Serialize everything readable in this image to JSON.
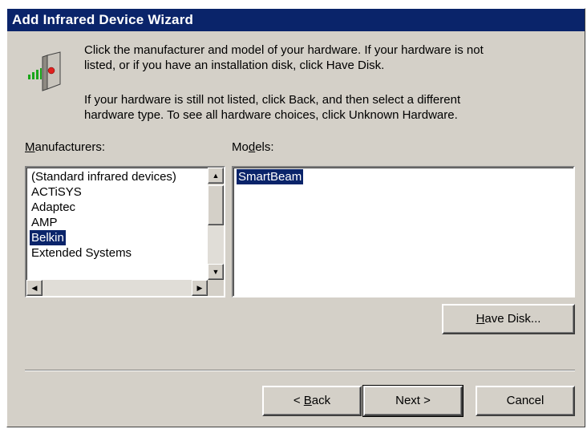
{
  "window": {
    "title": "Add Infrared Device Wizard"
  },
  "instructions": {
    "line1": "Click the manufacturer and model of your hardware. If your hardware is not",
    "line2": "listed, or if you have an installation disk, click Have Disk.",
    "line3": "If your hardware is still not listed, click Back, and then select a different",
    "line4": "hardware type. To see all hardware choices, click Unknown Hardware."
  },
  "manufacturers": {
    "label_mnemonic": "M",
    "label_rest": "anufacturers:",
    "items": [
      "(Standard infrared devices)",
      "ACTiSYS",
      "Adaptec",
      "AMP",
      "Belkin",
      "Extended Systems"
    ],
    "selected": "Belkin"
  },
  "models": {
    "label_pre": "Mo",
    "label_mnemonic": "d",
    "label_post": "els:",
    "items": [
      "SmartBeam"
    ],
    "selected": "SmartBeam"
  },
  "buttons": {
    "have_disk_mnemonic": "H",
    "have_disk_rest": "ave Disk...",
    "back_pre": "< ",
    "back_mnemonic": "B",
    "back_post": "ack",
    "next": "Next >",
    "cancel": "Cancel"
  },
  "icons": [
    "infrared-device-icon",
    "scroll-up-icon",
    "scroll-down-icon",
    "scroll-left-icon",
    "scroll-right-icon"
  ],
  "colors": {
    "titlebar": "#0a246a",
    "selection": "#0a246a",
    "face": "#d4d0c8"
  }
}
